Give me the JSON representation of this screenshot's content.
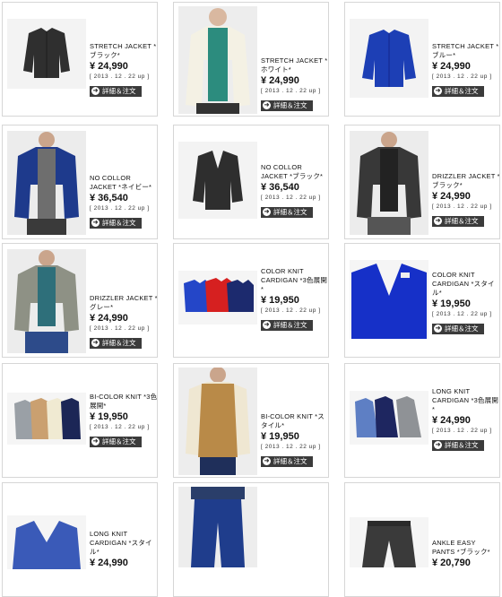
{
  "detail_label": "詳細＆注文",
  "products": [
    {
      "name": "STRETCH JACKET *ブラック*",
      "price": "¥ 24,990",
      "date": "[ 2013 . 12 . 22 up ]",
      "image": "black jacket"
    },
    {
      "name": "STRETCH JACKET *ホワイト*",
      "price": "¥ 24,990",
      "date": "[ 2013 . 12 . 22 up ]",
      "image": "white jacket on model"
    },
    {
      "name": "STRETCH JACKET *ブルー*",
      "price": "¥ 24,990",
      "date": "[ 2013 . 12 . 22 up ]",
      "image": "blue jacket"
    },
    {
      "name": "NO COLLOR JACKET *ネイビー*",
      "price": "¥ 36,540",
      "date": "[ 2013 . 12 . 22 up ]",
      "image": "navy jacket on model"
    },
    {
      "name": "NO COLLOR JACKET *ブラック*",
      "price": "¥ 36,540",
      "date": "[ 2013 . 12 . 22 up ]",
      "image": "black collarless jacket"
    },
    {
      "name": "DRIZZLER JACKET *ブラック*",
      "price": "¥ 24,990",
      "date": "[ 2013 . 12 . 22 up ]",
      "image": "black drizzler on model"
    },
    {
      "name": "DRIZZLER JACKET *グレー*",
      "price": "¥ 24,990",
      "date": "[ 2013 . 12 . 22 up ]",
      "image": "grey drizzler on model"
    },
    {
      "name": "COLOR KNIT CARDIGAN *3色展開*",
      "price": "¥ 19,950",
      "date": "[ 2013 . 12 . 22 up ]",
      "image": "three cardigans"
    },
    {
      "name": "COLOR KNIT CARDIGAN *スタイル*",
      "price": "¥ 19,950",
      "date": "[ 2013 . 12 . 22 up ]",
      "image": "blue cardigan"
    },
    {
      "name": "BI-COLOR KNIT *3色展開*",
      "price": "¥ 19,950",
      "date": "[ 2013 . 12 . 22 up ]",
      "image": "three knits"
    },
    {
      "name": "BI-COLOR KNIT *スタイル*",
      "price": "¥ 19,950",
      "date": "[ 2013 . 12 . 22 up ]",
      "image": "camel knit vest on model"
    },
    {
      "name": "LONG KNIT CARDIGAN *3色展開*",
      "price": "¥ 24,990",
      "date": "[ 2013 . 12 . 22 up ]",
      "image": "three long cardigans"
    },
    {
      "name": "LONG KNIT CARDIGAN *スタイル*",
      "price": "¥ 24,990",
      "date": "",
      "image": "blue long cardigan"
    },
    {
      "name": "",
      "price": "",
      "date": "",
      "image": "model in blue pants"
    },
    {
      "name": "ANKLE EASY PANTS *ブラック*",
      "price": "¥ 20,790",
      "date": "",
      "image": "black pants"
    }
  ]
}
